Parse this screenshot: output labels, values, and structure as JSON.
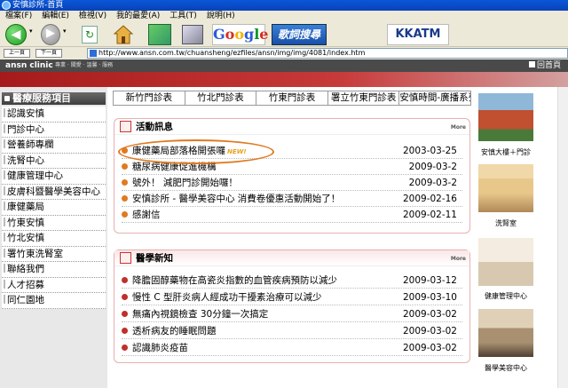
{
  "window": {
    "title": "安慎診所-首頁"
  },
  "menu": {
    "items": [
      "檔案(F)",
      "編輯(E)",
      "檢視(V)",
      "我的最愛(A)",
      "工具(T)",
      "說明(H)"
    ]
  },
  "toolbar": {
    "google_letters": [
      "G",
      "o",
      "o",
      "g",
      "l",
      "e"
    ],
    "lyrics_label": "歌詞搜尋",
    "kkatm_label": "KKATM"
  },
  "address": {
    "url": "http://www.ansn.com.tw/chuansheng/ezfiles/ansn/img/img/4081/index.htm",
    "back_label": "上一頁",
    "fwd_label": "下一頁"
  },
  "site": {
    "logo": "ansn clinic",
    "logo_sub": "專業 · 關愛 · 溫馨 · 服務",
    "home_link": "回首頁"
  },
  "left": {
    "header": "醫療服務項目",
    "items": [
      "認識安慎",
      "門診中心",
      "營養師專欄",
      "洗腎中心",
      "健康管理中心",
      "皮膚科暨醫學美容中心",
      "康健藥局",
      "竹東安慎",
      "竹北安慎",
      "署竹東洗腎室",
      "聯絡我們",
      "人才招募",
      "同仁園地"
    ]
  },
  "tabs": [
    "新竹門診表",
    "竹北門診表",
    "竹東門診表",
    "署立竹東門診表",
    "安慎時間-廣播系列"
  ],
  "activity": {
    "title": "活動訊息",
    "more": "More",
    "new_badge": "NEW!",
    "rows": [
      {
        "title": "康健藥局部落格開張囉",
        "date": "2003-03-25"
      },
      {
        "title": "糖尿病健康促進機構",
        "date": "2009-03-2"
      },
      {
        "title": "號外！ 減肥門診開始囉！",
        "date": "2009-03-2"
      },
      {
        "title": "安慎診所 - 醫學美容中心 消費卷優惠活動開始了！",
        "date": "2009-02-16"
      },
      {
        "title": "感謝信",
        "date": "2009-02-11"
      }
    ]
  },
  "medical": {
    "title": "醫學新知",
    "more": "More",
    "rows": [
      {
        "title": "降膽固醇藥物在高瓷炎指數的血管疾病預防以減少",
        "date": "2009-03-12"
      },
      {
        "title": "慢性 C 型肝炎病人經成功干擾素治療可以減少",
        "date": "2009-03-10"
      },
      {
        "title": "無痛內視鏡檢查 30分鐘一次搞定",
        "date": "2009-03-02"
      },
      {
        "title": "透析病友的睡眠問題",
        "date": "2009-03-02"
      },
      {
        "title": "認識肺炎疫苗",
        "date": "2009-03-02"
      }
    ]
  },
  "photos": [
    {
      "caption": "安慎大樓＋門診"
    },
    {
      "caption": "洗腎室"
    },
    {
      "caption": "健康管理中心"
    },
    {
      "caption": "醫學美容中心"
    }
  ],
  "colors": {
    "red_bar": "#a51a1a",
    "accent_orange": "#e07a20"
  }
}
